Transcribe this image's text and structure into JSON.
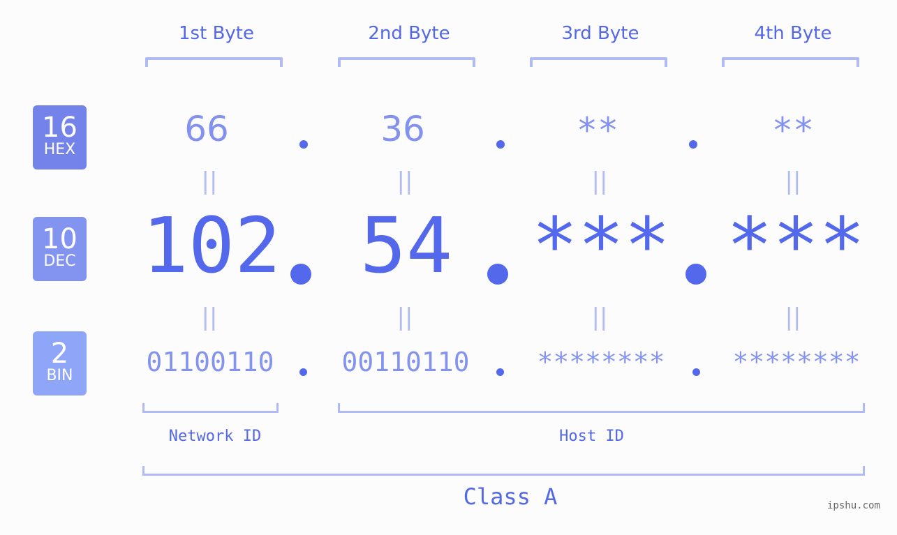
{
  "bytes": {
    "headers": [
      "1st Byte",
      "2nd Byte",
      "3rd Byte",
      "4th Byte"
    ]
  },
  "bases": {
    "hex": {
      "number": "16",
      "label": "HEX",
      "color": "#7383ea"
    },
    "dec": {
      "number": "10",
      "label": "DEC",
      "color": "#8293f0"
    },
    "bin": {
      "number": "2",
      "label": "BIN",
      "color": "#8fa5f7"
    }
  },
  "hex_values": [
    "66",
    "36",
    "**",
    "**"
  ],
  "dec_values": [
    "102",
    "54",
    "***",
    "***"
  ],
  "bin_values": [
    "01100110",
    "00110110",
    "********",
    "********"
  ],
  "equals_symbol": "||",
  "labels": {
    "network_id": "Network ID",
    "host_id": "Host ID",
    "class": "Class A"
  },
  "watermark": "ipshu.com",
  "colors": {
    "accent": "#5468ec",
    "bracket": "#b0bbf6",
    "light_value": "#8292ee"
  }
}
